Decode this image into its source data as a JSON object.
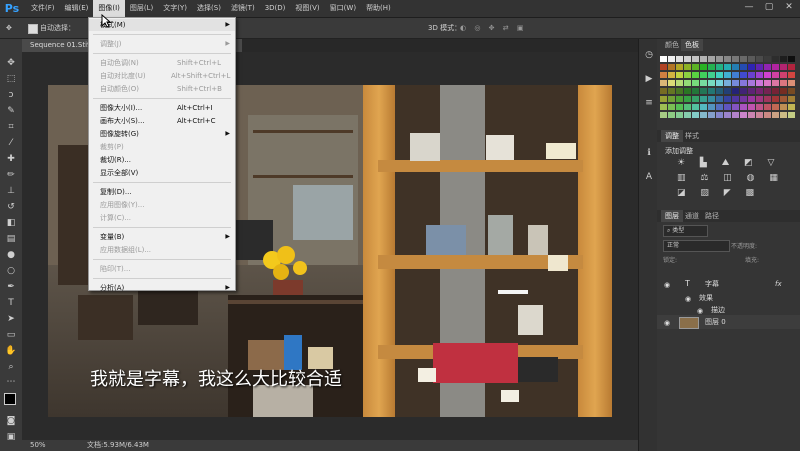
{
  "app": {
    "logo": "Ps"
  },
  "menubar": {
    "items": [
      "文件(F)",
      "编辑(E)",
      "图像(I)",
      "图层(L)",
      "文字(Y)",
      "选择(S)",
      "滤镜(T)",
      "3D(D)",
      "视图(V)",
      "窗口(W)",
      "帮助(H)"
    ],
    "active_index": 2
  },
  "window_controls": {
    "minimize": "—",
    "maximize": "▢",
    "close": "✕"
  },
  "options_bar": {
    "auto_select_label": "自动选择：",
    "mode_3d": "3D 模式："
  },
  "document": {
    "tab_title": "Sequence 01.Sti90",
    "zoom": "50%",
    "doc_info": "文档:5.93M/6.43M",
    "subtitle": "我就是字幕，我这么大比较合适"
  },
  "image_menu": {
    "items": [
      {
        "label": "模式(M)",
        "shortcut": "",
        "submenu": true,
        "disabled": false
      },
      {
        "label": "调整(J)",
        "shortcut": "",
        "submenu": true,
        "disabled": true
      },
      {
        "label": "自动色调(N)",
        "shortcut": "Shift+Ctrl+L",
        "submenu": false,
        "disabled": true
      },
      {
        "label": "自动对比度(U)",
        "shortcut": "Alt+Shift+Ctrl+L",
        "submenu": false,
        "disabled": true
      },
      {
        "label": "自动颜色(O)",
        "shortcut": "Shift+Ctrl+B",
        "submenu": false,
        "disabled": true
      },
      {
        "label": "图像大小(I)...",
        "shortcut": "Alt+Ctrl+I",
        "submenu": false,
        "disabled": false
      },
      {
        "label": "画布大小(S)...",
        "shortcut": "Alt+Ctrl+C",
        "submenu": false,
        "disabled": false
      },
      {
        "label": "图像旋转(G)",
        "shortcut": "",
        "submenu": true,
        "disabled": false
      },
      {
        "label": "裁剪(P)",
        "shortcut": "",
        "submenu": false,
        "disabled": true
      },
      {
        "label": "裁切(R)...",
        "shortcut": "",
        "submenu": false,
        "disabled": false
      },
      {
        "label": "显示全部(V)",
        "shortcut": "",
        "submenu": false,
        "disabled": false
      },
      {
        "label": "复制(D)...",
        "shortcut": "",
        "submenu": false,
        "disabled": false
      },
      {
        "label": "应用图像(Y)...",
        "shortcut": "",
        "submenu": false,
        "disabled": true
      },
      {
        "label": "计算(C)...",
        "shortcut": "",
        "submenu": false,
        "disabled": true
      },
      {
        "label": "变量(B)",
        "shortcut": "",
        "submenu": true,
        "disabled": false
      },
      {
        "label": "应用数据组(L)...",
        "shortcut": "",
        "submenu": false,
        "disabled": true
      },
      {
        "label": "陷印(T)...",
        "shortcut": "",
        "submenu": false,
        "disabled": true
      },
      {
        "label": "分析(A)",
        "shortcut": "",
        "submenu": true,
        "disabled": false
      }
    ]
  },
  "panels": {
    "color_tabs": [
      "颜色",
      "色板"
    ],
    "adjust_tabs": [
      "调整",
      "样式"
    ],
    "adjust_title": "添加调整",
    "layers_tabs": [
      "图层",
      "通道",
      "路径"
    ],
    "kind_label": "类型",
    "blend_mode": "正常",
    "opacity_label": "不透明度:",
    "lock_label": "锁定:",
    "fill_label": "填充:",
    "layers": [
      {
        "name": "字幕",
        "type": "text",
        "fx": "fx"
      },
      {
        "name": "效果",
        "type": "effects"
      },
      {
        "name": "描边",
        "type": "effect"
      },
      {
        "name": "图层 0",
        "type": "image"
      }
    ]
  },
  "colors": {
    "accent": "#36a2ff",
    "menu_bg": "#f0f0f0",
    "ui_dark": "#353535"
  }
}
